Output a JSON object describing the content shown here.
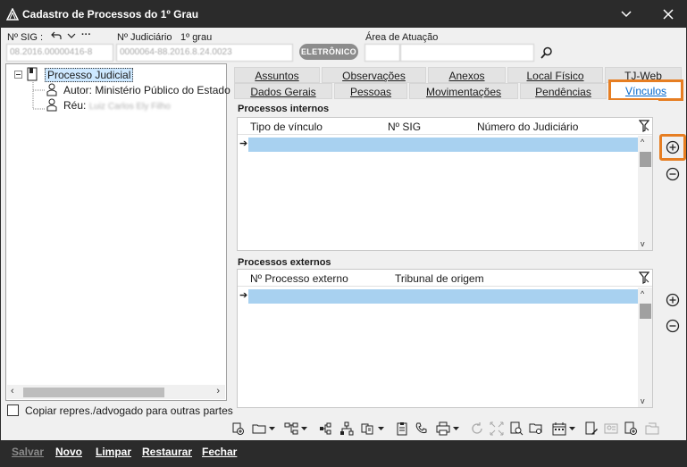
{
  "window": {
    "title": "Cadastro de Processos do 1º Grau",
    "min_icon": "chevron-down-icon",
    "close_icon": "close-icon"
  },
  "header": {
    "sig_label": "Nº SIG :",
    "sig_value": "08.2016.00000416-8",
    "judiciario_label": "Nº Judiciário",
    "grau_label": "1º grau",
    "judiciario_value": "0000064-88.2016.8.24.0023",
    "badge": "ELETRÔNICO",
    "area_label": "Área de Atuação",
    "area_value": ""
  },
  "tree": {
    "root": "Processo Judicial",
    "autor": "Autor: Ministério Público do Estado",
    "reu_label": "Réu:",
    "reu_name": "Luiz Carlos Ely Filho"
  },
  "copy_checkbox": {
    "label": "Copiar repres./advogado para outras partes",
    "checked": false
  },
  "tabs": {
    "row1": [
      "Assuntos",
      "Observações",
      "Anexos",
      "Local Físico",
      "TJ-Web"
    ],
    "row2": [
      "Dados Gerais",
      "Pessoas",
      "Movimentações",
      "Pendências",
      "Vínculos"
    ],
    "active": "Vínculos"
  },
  "internos": {
    "title": "Processos internos",
    "columns": [
      "Tipo de vínculo",
      "Nº SIG",
      "Número do Judiciário"
    ]
  },
  "externos": {
    "title": "Processos externos",
    "columns": [
      "Nº Processo externo",
      "Tribunal de origem"
    ]
  },
  "bottom": {
    "salvar": "Salvar",
    "novo": "Novo",
    "limpar": "Limpar",
    "restaurar": "Restaurar",
    "fechar": "Fechar"
  }
}
